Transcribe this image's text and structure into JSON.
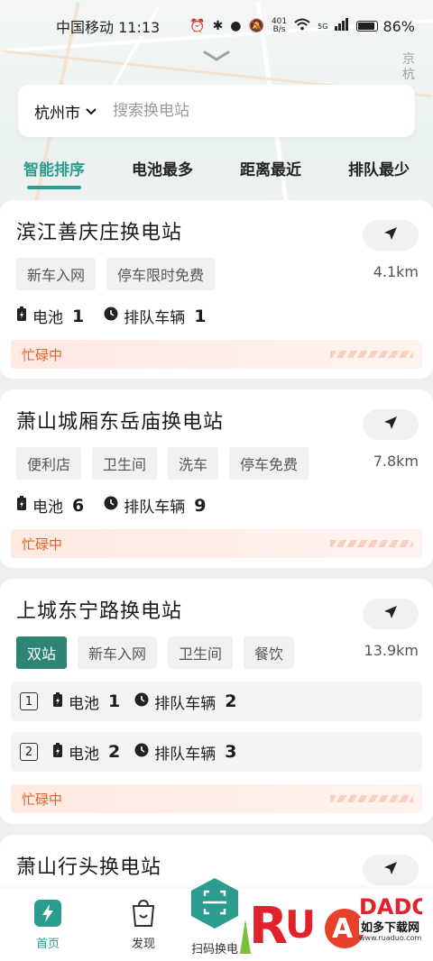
{
  "status_bar": {
    "carrier_time": "中国移动 11:13",
    "net_speed_top": "401",
    "net_speed_bottom": "B/s",
    "signal": "5G",
    "battery": "86%"
  },
  "map": {
    "label": "京杭"
  },
  "search": {
    "city": "杭州市",
    "placeholder": "搜索换电站"
  },
  "sort_tabs": [
    {
      "label": "智能排序",
      "active": true
    },
    {
      "label": "电池最多",
      "active": false
    },
    {
      "label": "距离最近",
      "active": false
    },
    {
      "label": "排队最少",
      "active": false
    }
  ],
  "labels": {
    "battery": "电池",
    "queue": "排队车辆"
  },
  "stations": [
    {
      "name": "滨江善庆庄换电站",
      "distance": "4.1km",
      "tags": [
        "新车入网",
        "停车限时免费"
      ],
      "battery": "1",
      "queue": "1",
      "status": "忙碌中"
    },
    {
      "name": "萧山城厢东岳庙换电站",
      "distance": "7.8km",
      "tags": [
        "便利店",
        "卫生间",
        "洗车",
        "停车免费"
      ],
      "battery": "6",
      "queue": "9",
      "status": "忙碌中"
    },
    {
      "name": "上城东宁路换电站",
      "distance": "13.9km",
      "highlight_tag": "双站",
      "tags": [
        "新车入网",
        "卫生间",
        "餐饮"
      ],
      "sub_stations": [
        {
          "index": "1",
          "battery": "1",
          "queue": "2"
        },
        {
          "index": "2",
          "battery": "2",
          "queue": "3"
        }
      ],
      "status": "忙碌中"
    },
    {
      "name": "萧山行头换电站"
    }
  ],
  "bottom_nav": {
    "home": "首页",
    "discover": "发现",
    "scan": "扫码换电"
  },
  "watermark": {
    "brand": "RUANDADO",
    "text": "如多下载网",
    "url": "www.ruaduo.com"
  },
  "colors": {
    "accent": "#2a9d8f",
    "busy": "#e0612e",
    "highlight_tag": "#2e8576"
  }
}
